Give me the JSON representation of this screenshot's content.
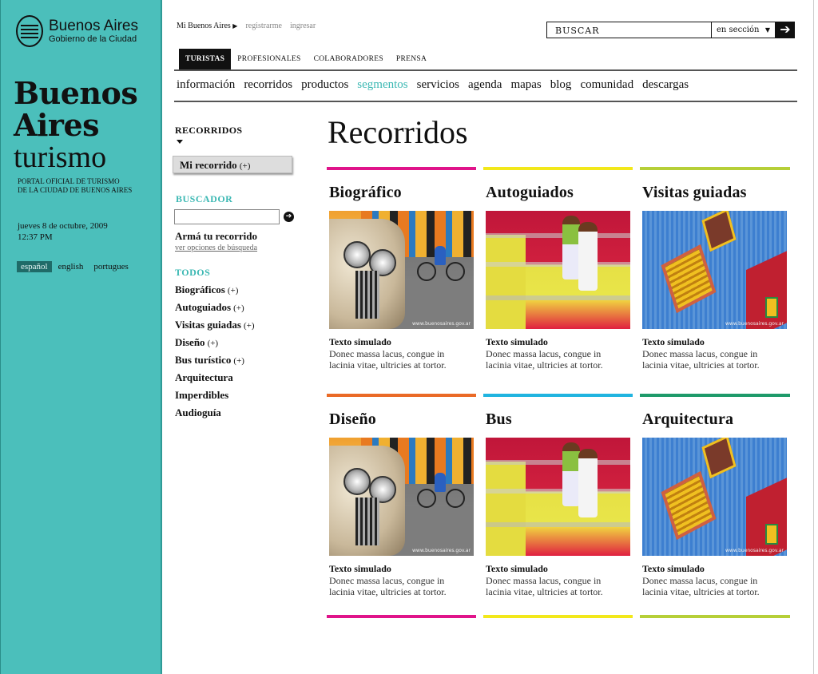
{
  "brand": {
    "logo_line1": "Buenos Aires",
    "logo_line2": "Gobierno de la Ciudad",
    "title_line1": "Buenos",
    "title_line2": "Aires",
    "title_line3": "turismo",
    "portal_line1": "PORTAL OFICIAL DE TURISMO",
    "portal_line2": "DE LA CIUDAD DE BUENOS AIRES",
    "date_line1": "jueves 8 de octubre, 2009",
    "date_line2": "12:37 PM",
    "accent_color": "#4bbfbb"
  },
  "languages": [
    {
      "label": "español",
      "active": true
    },
    {
      "label": "english",
      "active": false
    },
    {
      "label": "portugues",
      "active": false
    }
  ],
  "toplinks": {
    "mine": "Mi Buenos Aires",
    "register": "registrarme",
    "login": "ingresar"
  },
  "search": {
    "placeholder": "BUSCAR",
    "scope": "en sección",
    "go_icon": "arrow-right-icon"
  },
  "tabs": [
    {
      "label": "TURISTAS",
      "active": true
    },
    {
      "label": "PROFESIONALES",
      "active": false
    },
    {
      "label": "COLABORADORES",
      "active": false
    },
    {
      "label": "PRENSA",
      "active": false
    }
  ],
  "mainnav": [
    {
      "label": "información",
      "active": false
    },
    {
      "label": "recorridos",
      "active": false
    },
    {
      "label": "productos",
      "active": false
    },
    {
      "label": "segmentos",
      "active": true
    },
    {
      "label": "servicios",
      "active": false
    },
    {
      "label": "agenda",
      "active": false
    },
    {
      "label": "mapas",
      "active": false
    },
    {
      "label": "blog",
      "active": false
    },
    {
      "label": "comunidad",
      "active": false
    },
    {
      "label": "descargas",
      "active": false
    }
  ],
  "sidebar": {
    "header": "RECORRIDOS",
    "mi_recorrido": "Mi recorrido",
    "mi_recorrido_plus": "(+)",
    "buscador_label": "BUSCADOR",
    "arma_title": "Armá tu recorrido",
    "arma_link": "ver opciones de búsqueda",
    "todos_label": "TODOS",
    "categories": [
      {
        "label": "Biográficos",
        "plus": "(+)"
      },
      {
        "label": "Autoguiados",
        "plus": "(+)"
      },
      {
        "label": "Visitas guiadas",
        "plus": "(+)"
      },
      {
        "label": "Diseño",
        "plus": "(+)"
      },
      {
        "label": "Bus turístico",
        "plus": "(+)"
      },
      {
        "label": "Arquitectura",
        "plus": ""
      },
      {
        "label": "Imperdibles",
        "plus": ""
      },
      {
        "label": "Audioguía",
        "plus": ""
      }
    ]
  },
  "content": {
    "page_title": "Recorridos",
    "watermark": "www.buenosaires.gov.ar",
    "cards": [
      {
        "title": "Biográfico",
        "bar_color": "#e0148a",
        "photo": "car",
        "text_title": "Texto simulado",
        "text_line1": "Donec massa lacus, congue in",
        "text_line2": "lacinia vitae, ultricies at tortor."
      },
      {
        "title": "Autoguiados",
        "bar_color": "#f2e81a",
        "photo": "kids",
        "text_title": "Texto simulado",
        "text_line1": "Donec massa lacus, congue in",
        "text_line2": "lacinia vitae, ultricies at tortor."
      },
      {
        "title": "Visitas guiadas",
        "bar_color": "#b6cf38",
        "photo": "window",
        "text_title": "Texto simulado",
        "text_line1": "Donec massa lacus, congue in",
        "text_line2": "lacinia vitae, ultricies at tortor."
      },
      {
        "title": "Diseño",
        "bar_color": "#ea6a26",
        "photo": "car",
        "text_title": "Texto simulado",
        "text_line1": "Donec massa lacus, congue in",
        "text_line2": "lacinia vitae, ultricies at tortor."
      },
      {
        "title": "Bus",
        "bar_color": "#20b4e0",
        "photo": "kids",
        "text_title": "Texto simulado",
        "text_line1": "Donec massa lacus, congue in",
        "text_line2": "lacinia vitae, ultricies at tortor."
      },
      {
        "title": "Arquitectura",
        "bar_color": "#1e9a6a",
        "photo": "window",
        "text_title": "Texto simulado",
        "text_line1": "Donec massa lacus, congue in",
        "text_line2": "lacinia vitae, ultricies at tortor."
      }
    ],
    "bottom_bars": [
      "#e0148a",
      "#f2e81a",
      "#b6cf38"
    ]
  }
}
